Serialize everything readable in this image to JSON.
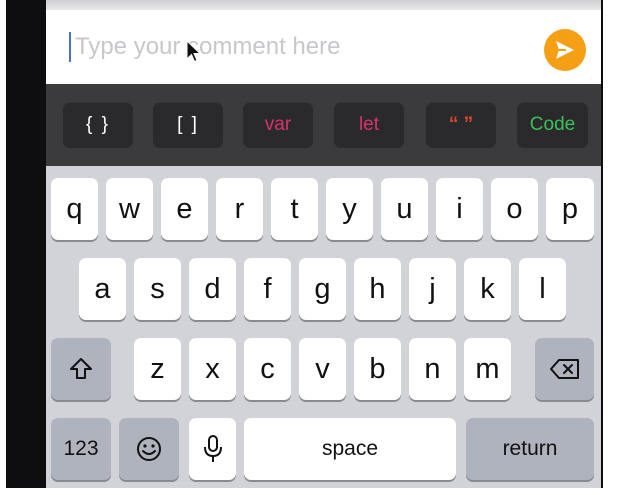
{
  "comment": {
    "placeholder": "Type your comment here",
    "send_icon": "paper-plane-icon"
  },
  "toolbar": {
    "buttons": [
      {
        "label": "{ }",
        "color": "#ffffff"
      },
      {
        "label": "[ ]",
        "color": "#ffffff"
      },
      {
        "label": "var",
        "color": "#d6336c"
      },
      {
        "label": "let",
        "color": "#d6336c"
      },
      {
        "label": "“ ”",
        "color": "#e0452d"
      },
      {
        "label": "Code",
        "color": "#3dbf5a"
      }
    ]
  },
  "keyboard": {
    "row1": [
      "q",
      "w",
      "e",
      "r",
      "t",
      "y",
      "u",
      "i",
      "o",
      "p"
    ],
    "row2": [
      "a",
      "s",
      "d",
      "f",
      "g",
      "h",
      "j",
      "k",
      "l"
    ],
    "row3": [
      "z",
      "x",
      "c",
      "v",
      "b",
      "n",
      "m"
    ],
    "numbers_label": "123",
    "space_label": "space",
    "return_label": "return",
    "shift_icon": "shift-icon",
    "delete_icon": "delete-icon",
    "emoji_icon": "emoji-icon",
    "mic_icon": "microphone-icon"
  },
  "colors": {
    "accent": "#f5a014",
    "toolbar_bg": "#3b3b3e",
    "keyboard_bg": "#d1d3d9"
  }
}
